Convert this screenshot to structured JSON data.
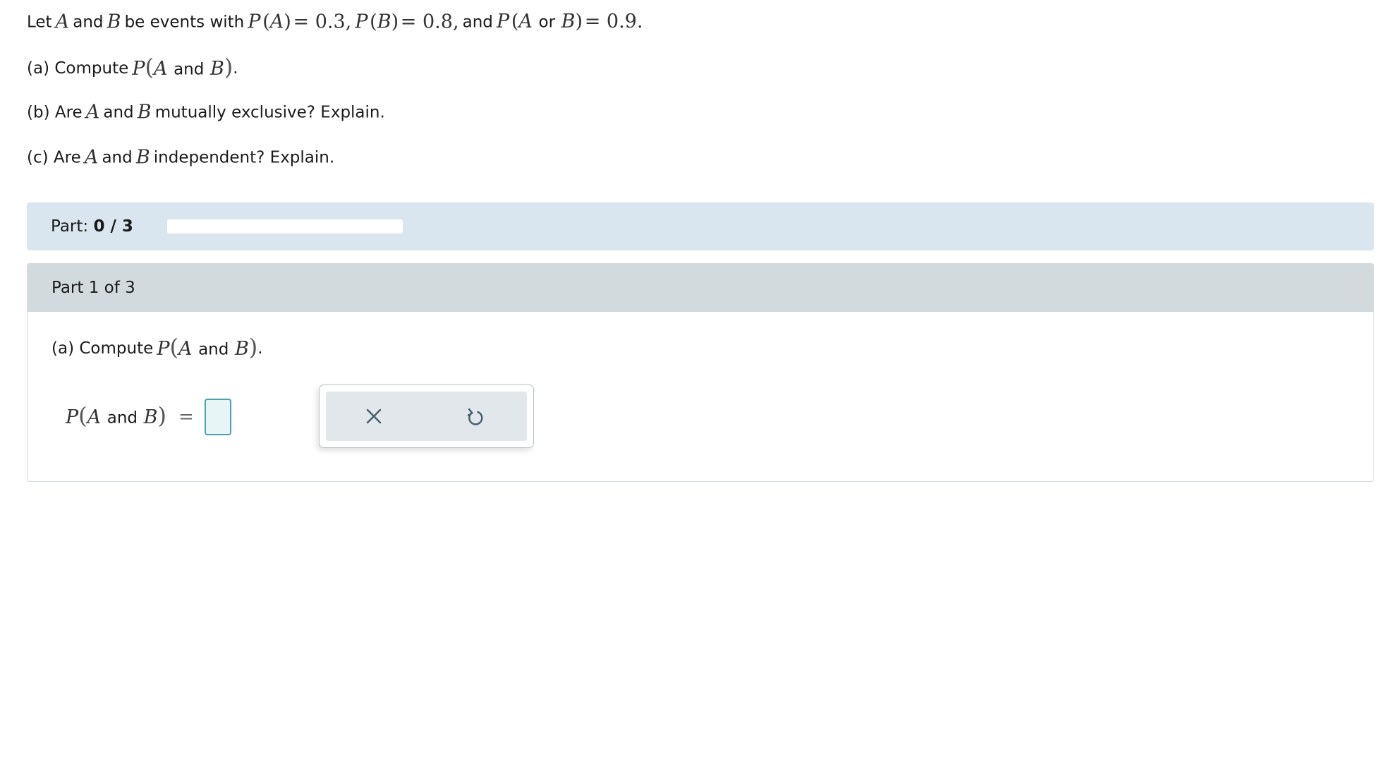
{
  "problem": {
    "intro": {
      "let": "Let",
      "A": "A",
      "and1": "and",
      "B": "B",
      "be_events_with": "be events with",
      "pA": "P",
      "pA_event": "A",
      "pA_value": "= 0.3,",
      "pB": "P",
      "pB_event": "B",
      "pB_value": "= 0.8,",
      "and2": "and",
      "pAorB": "P",
      "pAorB_A": "A",
      "or": "or",
      "pAorB_B": "B",
      "pAorB_value": "= 0.9."
    },
    "part_a": {
      "prefix": "(a) Compute",
      "P": "P",
      "A": "A",
      "and": "and",
      "B": "B",
      "suffix": "."
    },
    "part_b": {
      "prefix": "(b) Are",
      "A": "A",
      "and": "and",
      "B": "B",
      "suffix": "mutually exclusive? Explain."
    },
    "part_c": {
      "prefix": "(c) Are",
      "A": "A",
      "and": "and",
      "B": "B",
      "suffix": "independent? Explain."
    }
  },
  "progress": {
    "label": "Part:",
    "value": "0 / 3",
    "fraction": 0
  },
  "part": {
    "header": "Part 1 of 3",
    "question": {
      "prefix": "(a) Compute",
      "P": "P",
      "A": "A",
      "and": "and",
      "B": "B",
      "suffix": "."
    },
    "answer": {
      "P": "P",
      "A": "A",
      "and": "and",
      "B": "B",
      "equals": "=",
      "value": ""
    }
  },
  "tools": {
    "clear_icon": "close-icon",
    "undo_icon": "undo-icon"
  },
  "colors": {
    "progress_band": "#d9e6ef",
    "part_header": "#d3dadd",
    "input_border": "#4aa3a8",
    "input_bg": "#e8f5f7",
    "icon": "#3f5e6b"
  }
}
